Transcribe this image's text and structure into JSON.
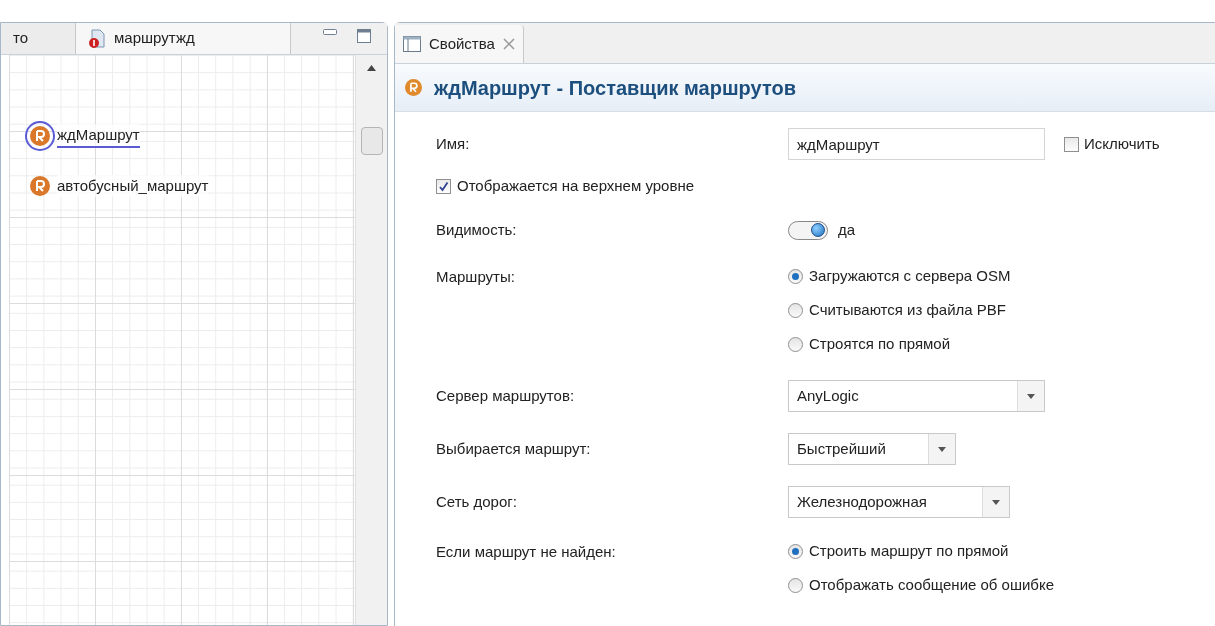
{
  "editor": {
    "tabs": [
      {
        "label": "то",
        "selected": false
      },
      {
        "label": "маршрутжд",
        "selected": true
      }
    ],
    "canvas_items": [
      {
        "label": "ждМаршрут",
        "selected": true
      },
      {
        "label": "автобусный_маршрут",
        "selected": false
      }
    ]
  },
  "properties": {
    "tab": "Свойства",
    "title": "ждМаршрут - Поставщик маршрутов",
    "fields": [
      {
        "kind": "text",
        "label": "Имя:",
        "value": "ждМаршрут",
        "checkbox_label": "Исключить",
        "checked": false
      },
      {
        "kind": "checkbox",
        "label": "Отображается на верхнем уровне",
        "checked": true
      },
      {
        "kind": "toggle",
        "label": "Видимость:",
        "on": true,
        "value": "да"
      },
      {
        "kind": "radio",
        "label": "Маршруты:",
        "options": [
          {
            "label": "Загружаются с сервера OSM",
            "selected": true
          },
          {
            "label": "Считываются из файла PBF",
            "selected": false
          },
          {
            "label": "Строятся по прямой",
            "selected": false
          }
        ]
      },
      {
        "kind": "dropdown",
        "label": "Сервер маршрутов:",
        "value": "AnyLogic"
      },
      {
        "kind": "dropdown",
        "label": "Выбирается маршрут:",
        "value": "Быстрейший"
      },
      {
        "kind": "dropdown",
        "label": "Сеть дорог:",
        "value": "Железнодорожная"
      },
      {
        "kind": "radio",
        "label": "Если маршрут не найден:",
        "options": [
          {
            "label": "Строить маршрут по прямой",
            "selected": true
          },
          {
            "label": "Отображать сообщение об ошибке",
            "selected": false
          }
        ]
      }
    ]
  }
}
